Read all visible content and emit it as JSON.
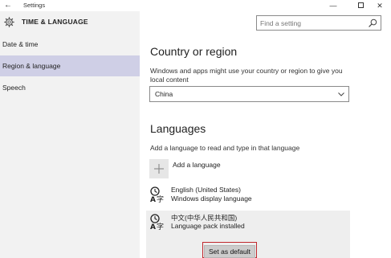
{
  "window": {
    "title": "Settings",
    "back_glyph": "←",
    "minimize_glyph": "—",
    "close_glyph": "✕"
  },
  "sidebar": {
    "title": "TIME & LANGUAGE",
    "icon": "gear-icon",
    "items": [
      {
        "label": "Date & time",
        "selected": false
      },
      {
        "label": "Region & language",
        "selected": true
      },
      {
        "label": "Speech",
        "selected": false
      }
    ]
  },
  "search": {
    "placeholder": "Find a setting",
    "icon": "search-icon"
  },
  "country": {
    "heading": "Country or region",
    "description": "Windows and apps might use your country or region to give you local content",
    "selected": "China"
  },
  "languages": {
    "heading": "Languages",
    "description": "Add a language to read and type in that language",
    "add_label": "Add a language",
    "items": [
      {
        "name": "English (United States)",
        "status": "Windows display language"
      },
      {
        "name": "中文(中华人民共和国)",
        "status": "Language pack installed"
      }
    ],
    "set_default_label": "Set as default"
  },
  "colors": {
    "sidebar_bg": "#f2f2f2",
    "selected_item_bg": "#cfcfe6",
    "highlight_border": "#c0282e"
  }
}
